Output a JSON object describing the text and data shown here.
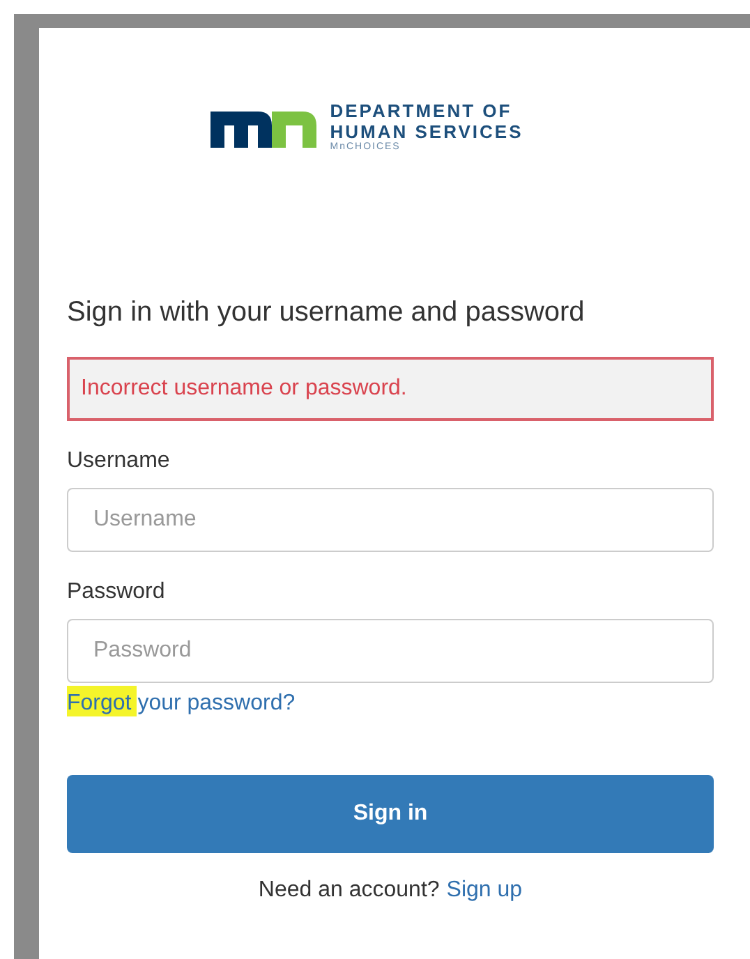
{
  "logo": {
    "line_1": "DEPARTMENT OF",
    "line_2": "HUMAN SERVICES",
    "line_3": "MnCHOICES"
  },
  "heading": "Sign in with your username and password",
  "error": "Incorrect username or password.",
  "fields": [
    {
      "label": "Username",
      "placeholder": "Username"
    },
    {
      "label": "Password",
      "placeholder": "Password"
    }
  ],
  "forgot_link": "Forgot your password?",
  "submit": "Sign in",
  "signup": {
    "prompt": "Need an account?",
    "link": "Sign up"
  }
}
